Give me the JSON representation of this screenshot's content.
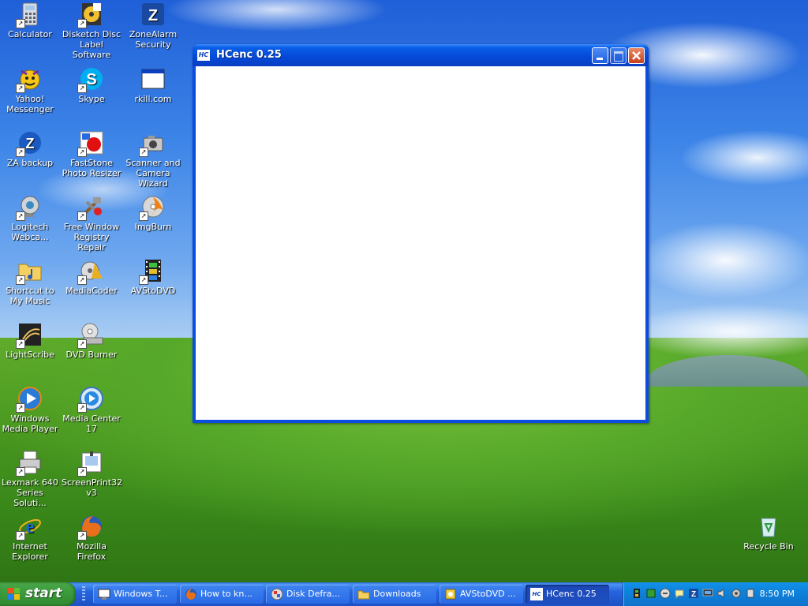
{
  "desktop": {
    "icons": [
      {
        "label": "Calculator"
      },
      {
        "label": "Disketch Disc Label Software"
      },
      {
        "label": "ZoneAlarm Security"
      },
      {
        "label": "Yahoo! Messenger"
      },
      {
        "label": "Skype"
      },
      {
        "label": "rkill.com"
      },
      {
        "label": "ZA backup"
      },
      {
        "label": "FastStone Photo Resizer"
      },
      {
        "label": "Scanner and Camera Wizard"
      },
      {
        "label": "Logitech Webca..."
      },
      {
        "label": "Free Window Registry Repair"
      },
      {
        "label": "ImgBurn"
      },
      {
        "label": "Shortcut to My Music"
      },
      {
        "label": "MediaCoder"
      },
      {
        "label": "AVStoDVD"
      },
      {
        "label": "LightScribe"
      },
      {
        "label": "DVD Burner"
      },
      {
        "label": "Windows Media Player"
      },
      {
        "label": "Media Center 17"
      },
      {
        "label": "Lexmark 640 Series Soluti..."
      },
      {
        "label": "ScreenPrint32 v3"
      },
      {
        "label": "Internet Explorer"
      },
      {
        "label": "Mozilla Firefox"
      },
      {
        "label": "Recycle Bin"
      }
    ]
  },
  "window": {
    "title": "HCenc 0.25",
    "app_icon_text": "HC"
  },
  "taskbar": {
    "start_label": "start",
    "tasks": [
      {
        "label": "Windows T..."
      },
      {
        "label": "How to kn..."
      },
      {
        "label": "Disk Defra..."
      },
      {
        "label": "Downloads"
      },
      {
        "label": "AVStoDVD ..."
      },
      {
        "label": "HCenc 0.25"
      }
    ],
    "clock": "8:50 PM"
  }
}
